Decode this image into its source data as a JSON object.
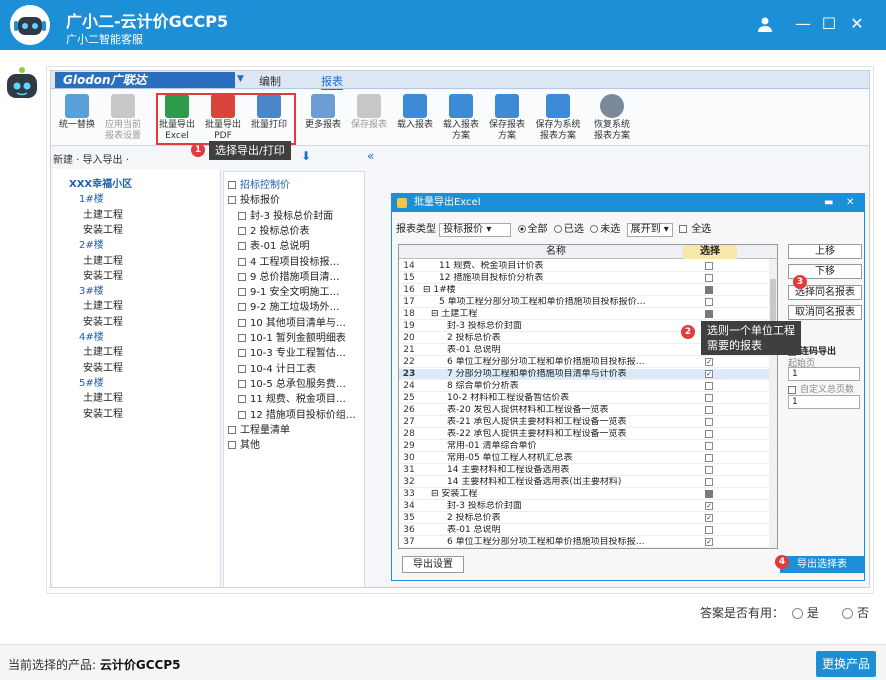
{
  "window": {
    "title": "广小二-云计价GCCP5",
    "subtitle": "广小二智能客服",
    "icons": [
      "user-icon",
      "restore-icon",
      "maximize-icon",
      "close-icon"
    ]
  },
  "software": {
    "logo": "Glodon广联达",
    "menu_tabs": [
      "编制",
      "报表"
    ],
    "ribbon": [
      {
        "label": "统一替换",
        "dis": false
      },
      {
        "label": "应用当前\n报表设置",
        "dis": true
      },
      {
        "label": "批量导出\nExcel",
        "dis": false
      },
      {
        "label": "批量导出\nPDF",
        "dis": false
      },
      {
        "label": "批量打印",
        "dis": false
      },
      {
        "label": "更多报表",
        "dis": false
      },
      {
        "label": "保存报表",
        "dis": true
      },
      {
        "label": "载入报表",
        "dis": false
      },
      {
        "label": "载入报表\n方案",
        "dis": false
      },
      {
        "label": "保存报表\n方案",
        "dis": false
      },
      {
        "label": "保存为系统\n报表方案",
        "dis": false
      },
      {
        "label": "恢复系统\n报表方案",
        "dis": false
      }
    ],
    "toolbar2": "新建 · 导入导出 ·",
    "annotation1": {
      "badge": "1",
      "tip": "选择导出/打印"
    },
    "left_tree": [
      {
        "label": "XXX幸福小区",
        "type": "root"
      },
      {
        "label": "1#楼",
        "type": "bld"
      },
      {
        "label": "土建工程",
        "type": "leaf"
      },
      {
        "label": "安装工程",
        "type": "leaf"
      },
      {
        "label": "2#楼",
        "type": "bld"
      },
      {
        "label": "土建工程",
        "type": "leaf"
      },
      {
        "label": "安装工程",
        "type": "leaf"
      },
      {
        "label": "3#楼",
        "type": "bld"
      },
      {
        "label": "土建工程",
        "type": "leaf"
      },
      {
        "label": "安装工程",
        "type": "leaf"
      },
      {
        "label": "4#楼",
        "type": "bld"
      },
      {
        "label": "土建工程",
        "type": "leaf"
      },
      {
        "label": "安装工程",
        "type": "leaf"
      },
      {
        "label": "5#楼",
        "type": "bld"
      },
      {
        "label": "土建工程",
        "type": "leaf"
      },
      {
        "label": "安装工程",
        "type": "leaf"
      }
    ],
    "mid_tree": [
      {
        "label": "招标控制价",
        "lvl": 0
      },
      {
        "label": "投标报价",
        "lvl": 0
      },
      {
        "label": "封-3 投标总价封面",
        "lvl": 1
      },
      {
        "label": "2 投标总价表",
        "lvl": 1
      },
      {
        "label": "表-01 总说明",
        "lvl": 1
      },
      {
        "label": "4 工程项目投标报…",
        "lvl": 1
      },
      {
        "label": "9 总价措施项目清…",
        "lvl": 1
      },
      {
        "label": "9-1 安全文明施工…",
        "lvl": 1
      },
      {
        "label": "9-2 施工垃圾场外…",
        "lvl": 1
      },
      {
        "label": "10 其他项目清单与…",
        "lvl": 1
      },
      {
        "label": "10-1 暂列金额明细表",
        "lvl": 1
      },
      {
        "label": "10-3 专业工程暂估…",
        "lvl": 1
      },
      {
        "label": "10-4 计日工表",
        "lvl": 1
      },
      {
        "label": "10-5 总承包服务费…",
        "lvl": 1
      },
      {
        "label": "11 规费、税金项目…",
        "lvl": 1
      },
      {
        "label": "12 措施项目投标价组…",
        "lvl": 1
      },
      {
        "label": "工程量清单",
        "lvl": 0
      },
      {
        "label": "其他",
        "lvl": 0
      }
    ],
    "dialog": {
      "title": "批量导出Excel",
      "filter_label": "报表类型",
      "filter_value": "投标报价",
      "radio_all": "全部",
      "radio_selected": "已选",
      "radio_unselected": "未选",
      "expand": "展开到",
      "select_all": "全选",
      "col_name": "名称",
      "col_select": "选择",
      "rows": [
        {
          "n": "14",
          "name": "11 规费、税金项目计价表",
          "ind": 2,
          "chk": "off"
        },
        {
          "n": "15",
          "name": "12 措施项目投标价分析表",
          "ind": 2,
          "chk": "off"
        },
        {
          "n": "16",
          "name": "⊟ 1#楼",
          "ind": 0,
          "chk": "part"
        },
        {
          "n": "17",
          "name": "5 单项工程分部分项工程和单价措施项目投标报价…",
          "ind": 2,
          "chk": "off"
        },
        {
          "n": "18",
          "name": "⊟ 土建工程",
          "ind": 1,
          "chk": "part"
        },
        {
          "n": "19",
          "name": "封-3 投标总价封面",
          "ind": 3,
          "chk": "off"
        },
        {
          "n": "20",
          "name": "2 投标总价表",
          "ind": 3,
          "chk": "off"
        },
        {
          "n": "21",
          "name": "表-01 总说明",
          "ind": 3,
          "chk": "off"
        },
        {
          "n": "22",
          "name": "6 单位工程分部分项工程和单价措施项目投标报…",
          "ind": 3,
          "chk": "on"
        },
        {
          "n": "23",
          "name": "7 分部分项工程和单价措施项目清单与计价表",
          "ind": 3,
          "chk": "on",
          "cur": true
        },
        {
          "n": "24",
          "name": "8 综合单价分析表",
          "ind": 3,
          "chk": "off"
        },
        {
          "n": "25",
          "name": "10-2 材料和工程设备暂估价表",
          "ind": 3,
          "chk": "off"
        },
        {
          "n": "26",
          "name": "表-20 发包人提供材料和工程设备一览表",
          "ind": 3,
          "chk": "off"
        },
        {
          "n": "27",
          "name": "表-21 承包人提供主要材料和工程设备一览表",
          "ind": 3,
          "chk": "off"
        },
        {
          "n": "28",
          "name": "表-22 承包人提供主要材料和工程设备一览表",
          "ind": 3,
          "chk": "off"
        },
        {
          "n": "29",
          "name": "常用-01 清单综合单价",
          "ind": 3,
          "chk": "off"
        },
        {
          "n": "30",
          "name": "常用-05 单位工程人材机汇总表",
          "ind": 3,
          "chk": "off"
        },
        {
          "n": "31",
          "name": "14 主要材料和工程设备选用表",
          "ind": 3,
          "chk": "off"
        },
        {
          "n": "32",
          "name": "14 主要材料和工程设备选用表(出主要材料)",
          "ind": 3,
          "chk": "off"
        },
        {
          "n": "33",
          "name": "⊟ 安装工程",
          "ind": 1,
          "chk": "part"
        },
        {
          "n": "34",
          "name": "封-3 投标总价封面",
          "ind": 3,
          "chk": "on"
        },
        {
          "n": "35",
          "name": "2 投标总价表",
          "ind": 3,
          "chk": "on"
        },
        {
          "n": "36",
          "name": "表-01 总说明",
          "ind": 3,
          "chk": "off"
        },
        {
          "n": "37",
          "name": "6 单位工程分部分项工程和单价措施项目投标报…",
          "ind": 3,
          "chk": "on"
        }
      ],
      "btn_up": "上移",
      "btn_down": "下移",
      "btn_select_same": "选择同名报表",
      "btn_cancel_same": "取消同名报表",
      "continuous": "连码导出",
      "start_page": "起始页",
      "start_val": "1",
      "custom_total": "自定义总页数",
      "custom_val": "1",
      "btn_export_settings": "导出设置",
      "btn_export_selected": "导出选择表"
    },
    "annotation2": {
      "badge": "2",
      "tip": "选则一个单位工程\n需要的报表"
    },
    "annotation3": {
      "badge": "3"
    },
    "annotation4": {
      "badge": "4"
    }
  },
  "feedback": {
    "question": "答案是否有用：",
    "yes": "是",
    "no": "否"
  },
  "footer": {
    "label": "当前选择的产品:",
    "product": "云计价GCCP5",
    "switch": "更换产品"
  },
  "colors": {
    "brand": "#1d8fd6",
    "highlight": "#e23b3b"
  }
}
